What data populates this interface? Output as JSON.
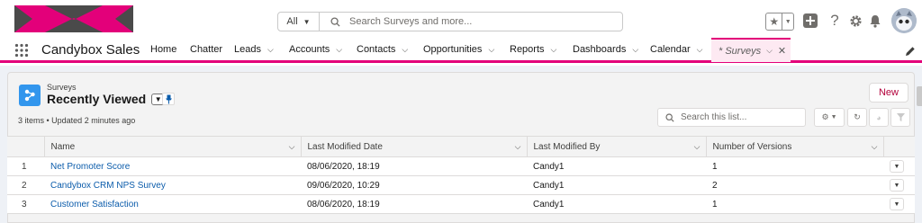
{
  "header": {
    "search_scope": "All",
    "search_placeholder": "Search Surveys and more...",
    "icons": [
      "favorites-star-icon",
      "favorites-caret-icon",
      "global-add-icon",
      "help-icon",
      "setup-gear-icon",
      "notifications-bell-icon",
      "user-avatar"
    ]
  },
  "nav": {
    "app_name": "Candybox Sales",
    "items": [
      {
        "label": "Home",
        "has_menu": false
      },
      {
        "label": "Chatter",
        "has_menu": false
      },
      {
        "label": "Leads",
        "has_menu": true
      },
      {
        "label": "Accounts",
        "has_menu": true
      },
      {
        "label": "Contacts",
        "has_menu": true
      },
      {
        "label": "Opportunities",
        "has_menu": true
      },
      {
        "label": "Reports",
        "has_menu": true
      },
      {
        "label": "Dashboards",
        "has_menu": true
      },
      {
        "label": "Calendar",
        "has_menu": true
      }
    ],
    "active_tab": {
      "prefix": "*",
      "label": "Surveys"
    }
  },
  "list_view": {
    "object_label": "Surveys",
    "title": "Recently Viewed",
    "meta": "3 items • Updated 2 minutes ago",
    "new_button": "New",
    "search_placeholder": "Search this list...",
    "columns": [
      "Name",
      "Last Modified Date",
      "Last Modified By",
      "Number of Versions"
    ],
    "rows": [
      {
        "num": "1",
        "name": "Net Promoter Score",
        "date": "08/06/2020, 18:19",
        "by": "Candy1",
        "versions": "1"
      },
      {
        "num": "2",
        "name": "Candybox CRM NPS Survey",
        "date": "09/06/2020, 10:29",
        "by": "Candy1",
        "versions": "2"
      },
      {
        "num": "3",
        "name": "Customer Satisfaction",
        "date": "08/06/2020, 18:19",
        "by": "Candy1",
        "versions": "1"
      }
    ]
  },
  "colors": {
    "brand_pink": "#e3007a",
    "link_blue": "#0b5cab",
    "survey_icon": "#3296ed"
  }
}
